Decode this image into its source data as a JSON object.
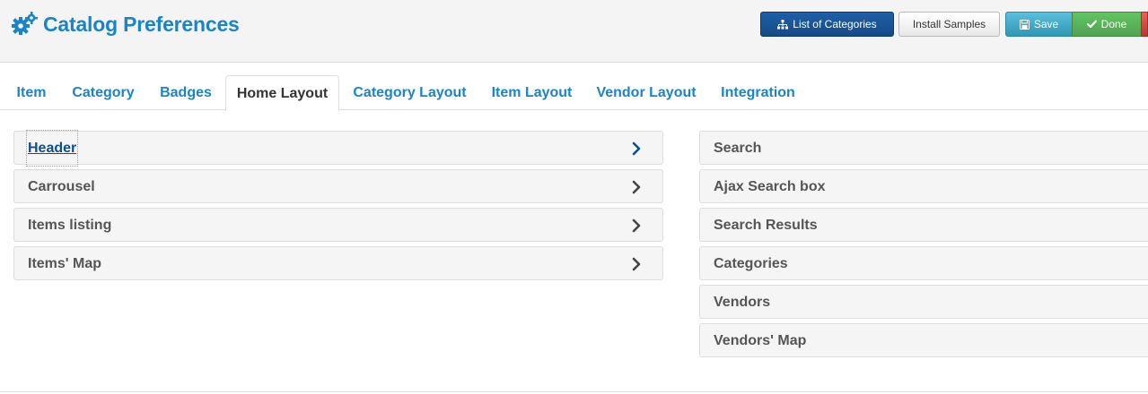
{
  "header": {
    "title": "Catalog Preferences",
    "title_icon": "gears-icon",
    "accent_color": "#1a84c7"
  },
  "toolbar": {
    "list_categories_label": "List of Categories",
    "install_samples_label": "Install Samples",
    "save_label": "Save",
    "done_label": "Done"
  },
  "tabs": [
    {
      "label": "Item",
      "active": false
    },
    {
      "label": "Category",
      "active": false
    },
    {
      "label": "Badges",
      "active": false
    },
    {
      "label": "Home Layout",
      "active": true
    },
    {
      "label": "Category Layout",
      "active": false
    },
    {
      "label": "Item Layout",
      "active": false
    },
    {
      "label": "Vendor Layout",
      "active": false
    },
    {
      "label": "Integration",
      "active": false
    }
  ],
  "left_panels": [
    {
      "label": "Header",
      "icon": "chevron-right-icon",
      "focused": true
    },
    {
      "label": "Carrousel",
      "icon": "chevron-right-icon"
    },
    {
      "label": "Items listing",
      "icon": "chevron-right-icon"
    },
    {
      "label": "Items' Map",
      "icon": "chevron-right-icon"
    }
  ],
  "right_panels": [
    {
      "label": "Search"
    },
    {
      "label": "Ajax Search box"
    },
    {
      "label": "Search Results"
    },
    {
      "label": "Categories"
    },
    {
      "label": "Vendors"
    },
    {
      "label": "Vendors' Map"
    }
  ]
}
